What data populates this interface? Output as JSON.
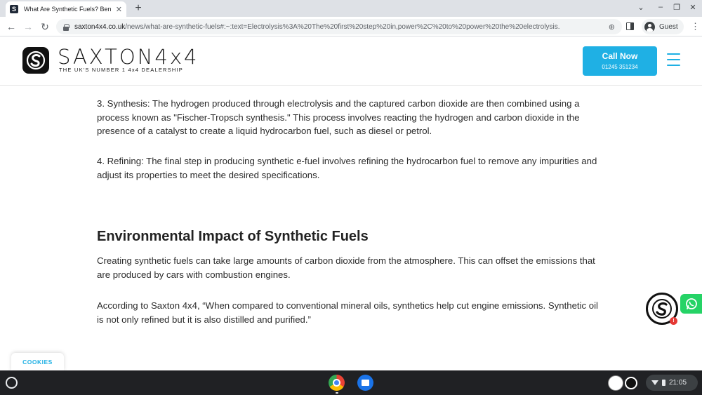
{
  "browser": {
    "tab_title": "What Are Synthetic Fuels? Benef",
    "tab_close": "✕",
    "new_tab": "+",
    "url_host": "saxton4x4.co.uk",
    "url_path": "/news/what-are-synthetic-fuels#:~:text=Electrolysis%3A%20The%20first%20step%20in,power%2C%20to%20power%20the%20electrolysis.",
    "profile_label": "Guest",
    "icons": [
      "back-icon",
      "forward-icon",
      "reload-icon",
      "lock-icon",
      "zoom-icon",
      "side-panel-icon",
      "profile-icon",
      "menu-icon"
    ]
  },
  "header": {
    "logo_word": "SAXTON4x4",
    "logo_tagline": "THE UK'S NUMBER 1 4x4 DEALERSHIP",
    "call_title": "Call Now",
    "call_phone": "01245 351234",
    "accent_color": "#1fb0e4"
  },
  "article": {
    "para_synthesis": "3. Synthesis: The hydrogen produced through electrolysis and the captured carbon dioxide are then combined using a process known as \"Fischer-Tropsch synthesis.\" This process involves reacting the hydrogen and carbon dioxide in the presence of a catalyst to create a liquid hydrocarbon fuel, such as diesel or petrol.",
    "para_refining": "4. Refining: The final step in producing synthetic e-fuel involves refining the hydrocarbon fuel to remove any impurities and adjust its properties to meet the desired specifications.",
    "heading": "Environmental Impact of Synthetic Fuels",
    "para_impact": "Creating synthetic fuels can take large amounts of carbon dioxide from the atmosphere. This can offset the emissions that are produced by cars with combustion engines.",
    "para_quote": "According to Saxton 4x4, “When compared to conventional mineral oils, synthetics help cut engine emissions. Synthetic oil is not only refined but it is also distilled and purified.”"
  },
  "widgets": {
    "cookies_label": "COOKIES",
    "chat_badge": "!",
    "whatsapp_color": "#25d366"
  },
  "shelf": {
    "clock": "21:05",
    "apps": [
      "chrome-icon",
      "files-icon"
    ]
  }
}
